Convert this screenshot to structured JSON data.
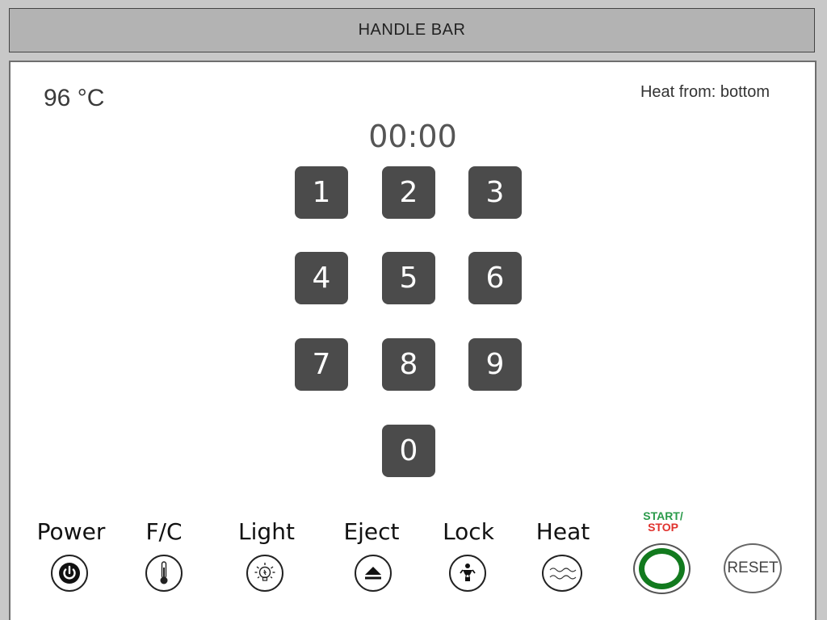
{
  "handle_bar": {
    "title": "HANDLE BAR"
  },
  "display": {
    "temperature": "96 °C",
    "heat_from": "Heat from: bottom",
    "timer": "00:00"
  },
  "keypad": {
    "keys": [
      "1",
      "2",
      "3",
      "4",
      "5",
      "6",
      "7",
      "8",
      "9",
      "0"
    ]
  },
  "controls": {
    "power": {
      "label": "Power",
      "icon": "power-icon"
    },
    "fc": {
      "label": "F/C",
      "icon": "thermometer-icon"
    },
    "light": {
      "label": "Light",
      "icon": "lightbulb-icon"
    },
    "eject": {
      "label": "Eject",
      "icon": "eject-icon"
    },
    "lock": {
      "label": "Lock",
      "icon": "child-lock-icon"
    },
    "heat": {
      "label": "Heat",
      "icon": "heat-waves-icon"
    },
    "start_stop": {
      "label_top": "START/",
      "label_bottom": "STOP",
      "ring_color": "#127a1e"
    },
    "reset": {
      "label": "RESET"
    }
  },
  "colors": {
    "key_bg": "#4b4b4b",
    "start_green": "#2a9a4a",
    "stop_red": "#e0322e"
  }
}
